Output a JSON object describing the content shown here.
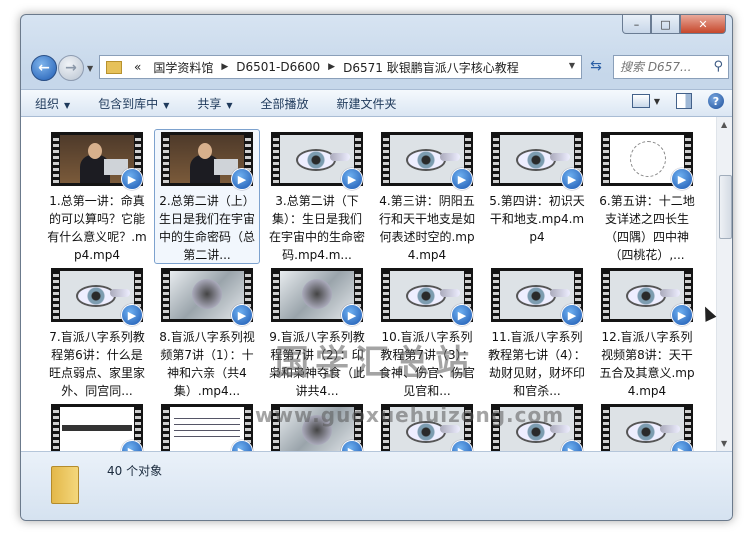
{
  "window": {
    "controls": {
      "minimize": "–",
      "maximize": "□",
      "close": "✕"
    }
  },
  "nav": {
    "back_icon": "arrow-left-icon",
    "forward_icon": "arrow-right-icon",
    "address": {
      "prefix": "«",
      "crumbs": [
        "国学资料馆",
        "D6501-D6600",
        "D6571 耿银鹏盲派八字核心教程"
      ]
    },
    "search_placeholder": "搜索 D657..."
  },
  "toolbar": {
    "organize": "组织",
    "include_in_library": "包含到库中",
    "share": "共享",
    "play_all": "全部播放",
    "new_folder": "新建文件夹"
  },
  "files": [
    {
      "name": "1.总第一讲：命真的可以算吗？它能有什么意义呢？.mp4.mp4",
      "thumb": "person"
    },
    {
      "name": "2.总第二讲（上）生日是我们在宇宙中的生命密码（总第二讲...",
      "thumb": "person",
      "selected": true
    },
    {
      "name": "3.总第二讲（下集）：生日是我们在宇宙中的生命密码.mp4.m...",
      "thumb": "eye"
    },
    {
      "name": "4.第三讲：阴阳五行和天干地支是如何表述时空的.mp4.mp4",
      "thumb": "eye"
    },
    {
      "name": "5.第四讲：初识天干和地支.mp4.mp4",
      "thumb": "eye"
    },
    {
      "name": "6.第五讲：十二地支详述之四长生（四隅）四中神（四桃花）,...",
      "thumb": "compass"
    },
    {
      "name": "7.盲派八字系列教程第6讲：什么是旺点弱点、家里家外、同宫同...",
      "thumb": "eye"
    },
    {
      "name": "8.盲派八字系列视频第7讲（1）：十神和六亲（共4集）.mp4...",
      "thumb": "ink"
    },
    {
      "name": "9.盲派八字系列教程第7讲（2）：印枭和枭神夺食（此讲共4...",
      "thumb": "ink"
    },
    {
      "name": "10.盲派八字系列教程第7讲（3）：食神、伤官、伤官见官和...",
      "thumb": "eye"
    },
    {
      "name": "11.盲派八字系列教程第七讲（4）：劫财见财，财坏印和官杀...",
      "thumb": "eye"
    },
    {
      "name": "12.盲派八字系列视频第8讲：天干五合及其意义.mp4.mp4",
      "thumb": "eye"
    },
    {
      "name": "",
      "thumb": "bigtext"
    },
    {
      "name": "",
      "thumb": "textslide"
    },
    {
      "name": "",
      "thumb": "ink"
    },
    {
      "name": "",
      "thumb": "eye"
    },
    {
      "name": "",
      "thumb": "eye"
    },
    {
      "name": "",
      "thumb": "eye"
    }
  ],
  "watermark": {
    "cn": "国学汇总站",
    "url": "www.guoxuehuizong.com"
  },
  "status": {
    "count": "40 个对象"
  }
}
